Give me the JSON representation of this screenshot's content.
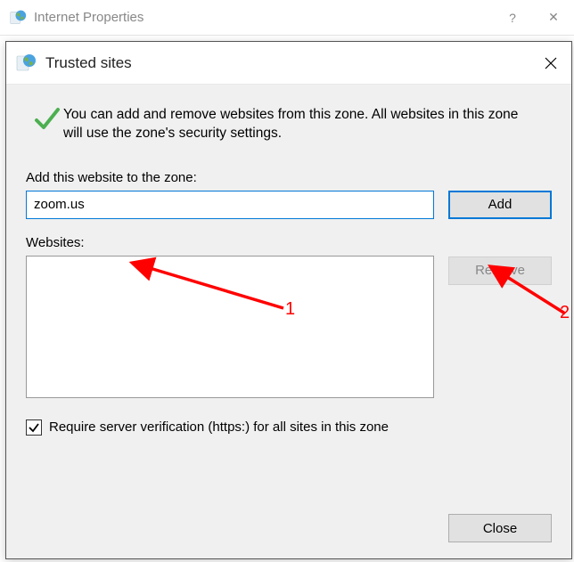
{
  "parent": {
    "title": "Internet Properties",
    "help_glyph": "?",
    "close_glyph": "✕"
  },
  "dialog": {
    "title": "Trusted sites",
    "info_text": "You can add and remove websites from this zone. All websites in this zone will use the zone's security settings.",
    "add_label": "Add this website to the zone:",
    "input_value": "zoom.us",
    "add_button": "Add",
    "websites_label": "Websites:",
    "remove_button": "Remove",
    "checkbox_label": "Require server verification (https:) for all sites in this zone",
    "checkbox_checked": true,
    "close_button": "Close"
  },
  "annotations": {
    "marker1": "1",
    "marker2": "2"
  }
}
